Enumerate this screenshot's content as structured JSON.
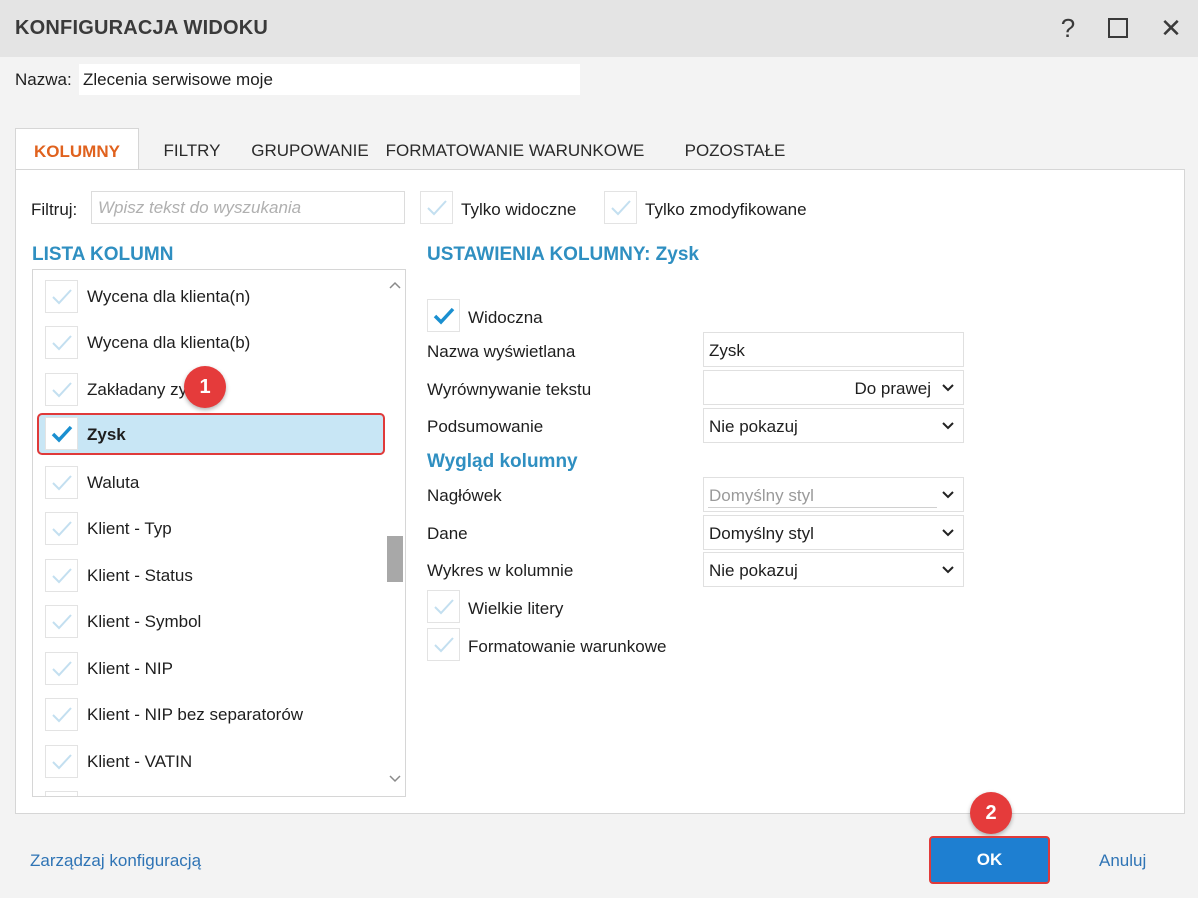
{
  "window": {
    "title": "KONFIGURACJA WIDOKU",
    "help_glyph": "?",
    "close_glyph": "✕"
  },
  "name_row": {
    "label": "Nazwa:",
    "value": "Zlecenia serwisowe moje"
  },
  "tabs": [
    {
      "label": "KOLUMNY",
      "active": true
    },
    {
      "label": "FILTRY",
      "active": false
    },
    {
      "label": "GRUPOWANIE",
      "active": false
    },
    {
      "label": "FORMATOWANIE WARUNKOWE",
      "active": false
    },
    {
      "label": "POZOSTAŁE",
      "active": false
    }
  ],
  "filter": {
    "label": "Filtruj:",
    "placeholder": "Wpisz tekst do wyszukania",
    "only_visible": {
      "label": "Tylko widoczne",
      "checked": false
    },
    "only_modified": {
      "label": "Tylko zmodyfikowane",
      "checked": false
    }
  },
  "column_list": {
    "title": "LISTA KOLUMN",
    "items": [
      {
        "label": "Wycena dla klienta(n)",
        "checked": false,
        "selected": false
      },
      {
        "label": "Wycena dla klienta(b)",
        "checked": false,
        "selected": false
      },
      {
        "label": "Zakładany zysk",
        "checked": false,
        "selected": false
      },
      {
        "label": "Zysk",
        "checked": true,
        "selected": true
      },
      {
        "label": "Waluta",
        "checked": false,
        "selected": false
      },
      {
        "label": "Klient - Typ",
        "checked": false,
        "selected": false
      },
      {
        "label": "Klient - Status",
        "checked": false,
        "selected": false
      },
      {
        "label": "Klient - Symbol",
        "checked": false,
        "selected": false
      },
      {
        "label": "Klient - NIP",
        "checked": false,
        "selected": false
      },
      {
        "label": "Klient - NIP bez separatorów",
        "checked": false,
        "selected": false
      },
      {
        "label": "Klient - VATIN",
        "checked": false,
        "selected": false
      }
    ]
  },
  "settings": {
    "title": "USTAWIENIA KOLUMNY: Zysk",
    "visible": {
      "label": "Widoczna",
      "checked": true
    },
    "display_name": {
      "label": "Nazwa wyświetlana",
      "value": "Zysk"
    },
    "text_align": {
      "label": "Wyrównywanie tekstu",
      "value": "Do prawej"
    },
    "summary": {
      "label": "Podsumowanie",
      "value": "Nie pokazuj"
    },
    "appearance_title": "Wygląd kolumny",
    "header": {
      "label": "Nagłówek",
      "value": "Domyślny styl"
    },
    "data": {
      "label": "Dane",
      "value": "Domyślny styl"
    },
    "chart": {
      "label": "Wykres w kolumnie",
      "value": "Nie pokazuj"
    },
    "uppercase": {
      "label": "Wielkie litery",
      "checked": false
    },
    "conditional": {
      "label": "Formatowanie warunkowe",
      "checked": false
    }
  },
  "badges": {
    "one": "1",
    "two": "2"
  },
  "footer": {
    "manage_link": "Zarządzaj konfiguracją",
    "ok": "OK",
    "cancel": "Anuluj"
  },
  "colors": {
    "accent_blue": "#2f8fc1",
    "tab_active": "#e0621e",
    "ok_button": "#1e7fd1",
    "highlight_red": "#e03a3a",
    "selection": "#c8e6f5"
  }
}
